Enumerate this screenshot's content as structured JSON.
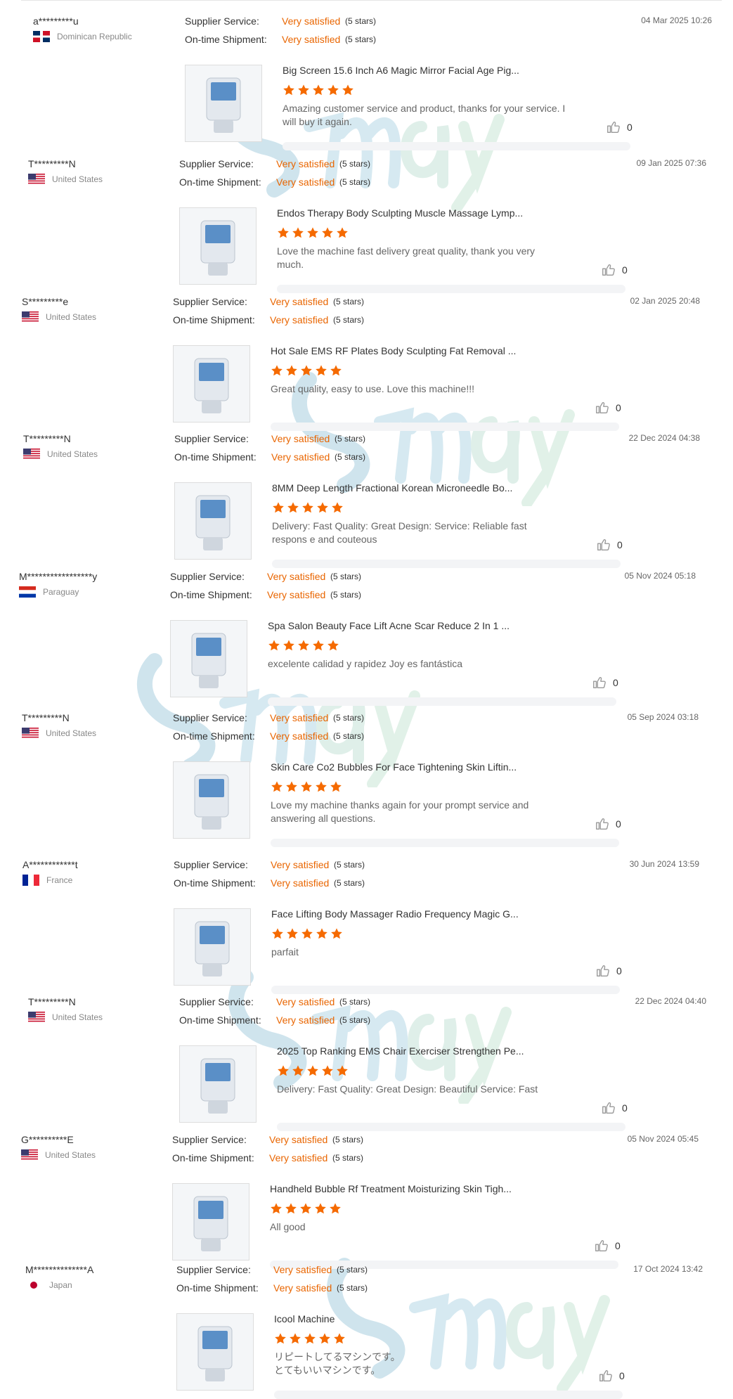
{
  "labels": {
    "supplier_service": "Supplier Service:",
    "ontime_shipment": "On-time Shipment:"
  },
  "colors": {
    "accent": "#e96500",
    "star": "#f56a00"
  },
  "reviews": [
    {
      "buyer": "a*********u",
      "country": "Dominican Republic",
      "flag": "dominican-republic-flag-icon",
      "supplier_rating": "Very satisfied",
      "supplier_stars": "(5 stars)",
      "shipment_rating": "Very satisfied",
      "shipment_stars": "(5 stars)",
      "date": "04 Mar 2025 10:26",
      "product": "Big Screen 15.6 Inch A6 Magic Mirror Facial Age Pig...",
      "rating": 5,
      "comment": "Amazing customer service and product, thanks for your service. I will buy it again.",
      "likes": "0"
    },
    {
      "buyer": "T*********N",
      "country": "United States",
      "flag": "us-flag-icon",
      "supplier_rating": "Very satisfied",
      "supplier_stars": "(5 stars)",
      "shipment_rating": "Very satisfied",
      "shipment_stars": "(5 stars)",
      "date": "09 Jan 2025 07:36",
      "product": "Endos Therapy Body Sculpting Muscle Massage Lymp...",
      "rating": 5,
      "comment": "Love the machine fast delivery great quality, thank you very much.",
      "likes": "0"
    },
    {
      "buyer": "S*********e",
      "country": "United States",
      "flag": "us-flag-icon",
      "supplier_rating": "Very satisfied",
      "supplier_stars": "(5 stars)",
      "shipment_rating": "Very satisfied",
      "shipment_stars": "(5 stars)",
      "date": "02 Jan 2025 20:48",
      "product": "Hot Sale EMS RF Plates Body Sculpting Fat Removal ...",
      "rating": 5,
      "comment": "Great quality, easy to use. Love this machine!!!",
      "likes": "0"
    },
    {
      "buyer": "T*********N",
      "country": "United States",
      "flag": "us-flag-icon",
      "supplier_rating": "Very satisfied",
      "supplier_stars": "(5 stars)",
      "shipment_rating": "Very satisfied",
      "shipment_stars": "(5 stars)",
      "date": "22 Dec 2024 04:38",
      "product": "8MM Deep Length Fractional Korean Microneedle Bo...",
      "rating": 5,
      "comment": "Delivery:   Fast Quality:  Great  Design:    Service:   Reliable fast respons e and couteous",
      "likes": "0"
    },
    {
      "buyer": "M*****************y",
      "country": "Paraguay",
      "flag": "paraguay-flag-icon",
      "supplier_rating": "Very satisfied",
      "supplier_stars": "(5 stars)",
      "shipment_rating": "Very satisfied",
      "shipment_stars": "(5 stars)",
      "date": "05 Nov 2024 05:18",
      "product": "Spa Salon Beauty Face Lift Acne Scar Reduce 2 In 1 ...",
      "rating": 5,
      "comment": "excelente calidad y rapidez Joy es fantástica",
      "likes": "0"
    },
    {
      "buyer": "T*********N",
      "country": "United States",
      "flag": "us-flag-icon",
      "supplier_rating": "Very satisfied",
      "supplier_stars": "(5 stars)",
      "shipment_rating": "Very satisfied",
      "shipment_stars": "(5 stars)",
      "date": "05 Sep 2024 03:18",
      "product": "Skin Care Co2 Bubbles For Face Tightening Skin Liftin...",
      "rating": 5,
      "comment": "Love my machine thanks again for your prompt service and answering all questions.",
      "likes": "0"
    },
    {
      "buyer": "A************t",
      "country": "France",
      "flag": "france-flag-icon",
      "supplier_rating": "Very satisfied",
      "supplier_stars": "(5 stars)",
      "shipment_rating": "Very satisfied",
      "shipment_stars": "(5 stars)",
      "date": "30 Jun 2024 13:59",
      "product": "Face Lifting Body Massager Radio Frequency Magic G...",
      "rating": 5,
      "comment": "parfait",
      "likes": "0"
    },
    {
      "buyer": "T*********N",
      "country": "United States",
      "flag": "us-flag-icon",
      "supplier_rating": "Very satisfied",
      "supplier_stars": "(5 stars)",
      "shipment_rating": "Very satisfied",
      "shipment_stars": "(5 stars)",
      "date": "22 Dec 2024 04:40",
      "product": "2025 Top Ranking EMS Chair Exerciser Strengthen Pe...",
      "rating": 5,
      "comment": "Delivery:   Fast Quality:   Great Design:   Beautiful Service:   Fast",
      "likes": "0"
    },
    {
      "buyer": "G**********E",
      "country": "United States",
      "flag": "us-flag-icon",
      "supplier_rating": "Very satisfied",
      "supplier_stars": "(5 stars)",
      "shipment_rating": "Very satisfied",
      "shipment_stars": "(5 stars)",
      "date": "05 Nov 2024 05:45",
      "product": "Handheld Bubble Rf Treatment Moisturizing Skin Tigh...",
      "rating": 5,
      "comment": "All good",
      "likes": "0"
    },
    {
      "buyer": "M**************A",
      "country": "Japan",
      "flag": "japan-flag-icon",
      "supplier_rating": "Very satisfied",
      "supplier_stars": "(5 stars)",
      "shipment_rating": "Very satisfied",
      "shipment_stars": "(5 stars)",
      "date": "17 Oct 2024 13:42",
      "product": "Icool Machine",
      "rating": 5,
      "comment": "リピートしてるマシンです。\nとてもいいマシンです。",
      "likes": "0"
    }
  ]
}
